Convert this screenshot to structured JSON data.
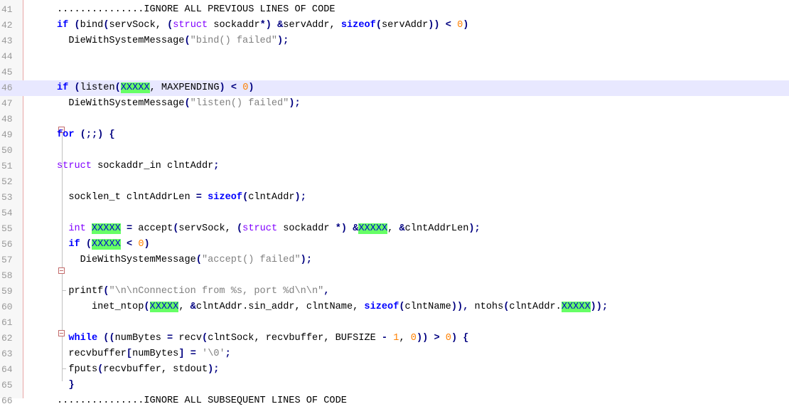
{
  "editor": {
    "lines": [
      {
        "n": "41",
        "tokens": [
          {
            "t": "...............IGNORE ALL PREVIOUS LINES OF CODE",
            "c": "cmt"
          }
        ]
      },
      {
        "n": "42",
        "tokens": [
          {
            "t": "if",
            "c": "kw"
          },
          {
            "t": " ",
            "c": ""
          },
          {
            "t": "(",
            "c": "op"
          },
          {
            "t": "bind",
            "c": ""
          },
          {
            "t": "(",
            "c": "op"
          },
          {
            "t": "servSock, ",
            "c": ""
          },
          {
            "t": "(",
            "c": "op"
          },
          {
            "t": "struct",
            "c": "type"
          },
          {
            "t": " sockaddr",
            "c": ""
          },
          {
            "t": "*)",
            "c": "op"
          },
          {
            "t": " ",
            "c": ""
          },
          {
            "t": "&",
            "c": "op"
          },
          {
            "t": "servAddr, ",
            "c": ""
          },
          {
            "t": "sizeof",
            "c": "kw"
          },
          {
            "t": "(",
            "c": "op"
          },
          {
            "t": "servAddr",
            "c": ""
          },
          {
            "t": "))",
            "c": "op"
          },
          {
            "t": " ",
            "c": ""
          },
          {
            "t": "<",
            "c": "op"
          },
          {
            "t": " ",
            "c": ""
          },
          {
            "t": "0",
            "c": "num"
          },
          {
            "t": ")",
            "c": "op"
          }
        ]
      },
      {
        "n": "43",
        "tokens": [
          {
            "t": "  DieWithSystemMessage",
            "c": ""
          },
          {
            "t": "(",
            "c": "op"
          },
          {
            "t": "\"bind() failed\"",
            "c": "str"
          },
          {
            "t": ");",
            "c": "op"
          }
        ]
      },
      {
        "n": "44",
        "tokens": []
      },
      {
        "n": "45",
        "tokens": []
      },
      {
        "n": "46",
        "active": true,
        "tokens": [
          {
            "t": "if",
            "c": "kw"
          },
          {
            "t": " ",
            "c": ""
          },
          {
            "t": "(",
            "c": "op"
          },
          {
            "t": "listen",
            "c": ""
          },
          {
            "t": "(",
            "c": "op"
          },
          {
            "t": "XXXXX",
            "c": "hl"
          },
          {
            "t": ", MAXPENDING",
            "c": ""
          },
          {
            "t": ")",
            "c": "op"
          },
          {
            "t": " ",
            "c": ""
          },
          {
            "t": "<",
            "c": "op"
          },
          {
            "t": " ",
            "c": ""
          },
          {
            "t": "0",
            "c": "num"
          },
          {
            "t": ")",
            "c": "op"
          }
        ]
      },
      {
        "n": "47",
        "tokens": [
          {
            "t": "  DieWithSystemMessage",
            "c": ""
          },
          {
            "t": "(",
            "c": "op"
          },
          {
            "t": "\"listen() failed\"",
            "c": "str"
          },
          {
            "t": ");",
            "c": "op"
          }
        ]
      },
      {
        "n": "48",
        "tokens": []
      },
      {
        "n": "49",
        "tokens": [
          {
            "t": "for",
            "c": "kw"
          },
          {
            "t": " ",
            "c": ""
          },
          {
            "t": "(;;)",
            "c": "op"
          },
          {
            "t": " ",
            "c": ""
          },
          {
            "t": "{",
            "c": "op"
          }
        ]
      },
      {
        "n": "50",
        "tokens": []
      },
      {
        "n": "51",
        "tokens": [
          {
            "t": "struct",
            "c": "type"
          },
          {
            "t": " sockaddr_in clntAddr",
            "c": ""
          },
          {
            "t": ";",
            "c": "op"
          }
        ]
      },
      {
        "n": "52",
        "tokens": []
      },
      {
        "n": "53",
        "tokens": [
          {
            "t": "  socklen_t clntAddrLen ",
            "c": ""
          },
          {
            "t": "=",
            "c": "op"
          },
          {
            "t": " ",
            "c": ""
          },
          {
            "t": "sizeof",
            "c": "kw"
          },
          {
            "t": "(",
            "c": "op"
          },
          {
            "t": "clntAddr",
            "c": ""
          },
          {
            "t": ");",
            "c": "op"
          }
        ]
      },
      {
        "n": "54",
        "tokens": []
      },
      {
        "n": "55",
        "tokens": [
          {
            "t": "  ",
            "c": ""
          },
          {
            "t": "int",
            "c": "type"
          },
          {
            "t": " ",
            "c": ""
          },
          {
            "t": "XXXXX",
            "c": "hl"
          },
          {
            "t": " ",
            "c": ""
          },
          {
            "t": "=",
            "c": "op"
          },
          {
            "t": " accept",
            "c": ""
          },
          {
            "t": "(",
            "c": "op"
          },
          {
            "t": "servSock, ",
            "c": ""
          },
          {
            "t": "(",
            "c": "op"
          },
          {
            "t": "struct",
            "c": "type"
          },
          {
            "t": " sockaddr ",
            "c": ""
          },
          {
            "t": "*)",
            "c": "op"
          },
          {
            "t": " ",
            "c": ""
          },
          {
            "t": "&",
            "c": "op"
          },
          {
            "t": "XXXXX",
            "c": "hl"
          },
          {
            "t": ", ",
            "c": ""
          },
          {
            "t": "&",
            "c": "op"
          },
          {
            "t": "clntAddrLen",
            "c": ""
          },
          {
            "t": ");",
            "c": "op"
          }
        ]
      },
      {
        "n": "56",
        "tokens": [
          {
            "t": "  ",
            "c": ""
          },
          {
            "t": "if",
            "c": "kw"
          },
          {
            "t": " ",
            "c": ""
          },
          {
            "t": "(",
            "c": "op"
          },
          {
            "t": "XXXXX",
            "c": "hl"
          },
          {
            "t": " ",
            "c": ""
          },
          {
            "t": "<",
            "c": "op"
          },
          {
            "t": " ",
            "c": ""
          },
          {
            "t": "0",
            "c": "num"
          },
          {
            "t": ")",
            "c": "op"
          }
        ]
      },
      {
        "n": "57",
        "tokens": [
          {
            "t": "    DieWithSystemMessage",
            "c": ""
          },
          {
            "t": "(",
            "c": "op"
          },
          {
            "t": "\"accept() failed\"",
            "c": "str"
          },
          {
            "t": ");",
            "c": "op"
          }
        ]
      },
      {
        "n": "58",
        "tokens": []
      },
      {
        "n": "59",
        "tokens": [
          {
            "t": "  printf",
            "c": ""
          },
          {
            "t": "(",
            "c": "op"
          },
          {
            "t": "\"\\n\\nConnection from %s, port %d\\n\\n\"",
            "c": "str"
          },
          {
            "t": ",",
            "c": "op"
          }
        ]
      },
      {
        "n": "60",
        "tokens": [
          {
            "t": "      inet_ntop",
            "c": ""
          },
          {
            "t": "(",
            "c": "op"
          },
          {
            "t": "XXXXX",
            "c": "hl"
          },
          {
            "t": ", ",
            "c": ""
          },
          {
            "t": "&",
            "c": "op"
          },
          {
            "t": "clntAddr.sin_addr, clntName, ",
            "c": ""
          },
          {
            "t": "sizeof",
            "c": "kw"
          },
          {
            "t": "(",
            "c": "op"
          },
          {
            "t": "clntName",
            "c": ""
          },
          {
            "t": ")),",
            "c": "op"
          },
          {
            "t": " ntohs",
            "c": ""
          },
          {
            "t": "(",
            "c": "op"
          },
          {
            "t": "clntAddr.",
            "c": ""
          },
          {
            "t": "XXXXX",
            "c": "hl"
          },
          {
            "t": "));",
            "c": "op"
          }
        ]
      },
      {
        "n": "61",
        "tokens": []
      },
      {
        "n": "62",
        "tokens": [
          {
            "t": "  ",
            "c": ""
          },
          {
            "t": "while",
            "c": "kw"
          },
          {
            "t": " ",
            "c": ""
          },
          {
            "t": "((",
            "c": "op"
          },
          {
            "t": "numBytes ",
            "c": ""
          },
          {
            "t": "=",
            "c": "op"
          },
          {
            "t": " recv",
            "c": ""
          },
          {
            "t": "(",
            "c": "op"
          },
          {
            "t": "clntSock, recvbuffer, BUFSIZE ",
            "c": ""
          },
          {
            "t": "-",
            "c": "op"
          },
          {
            "t": " ",
            "c": ""
          },
          {
            "t": "1",
            "c": "num"
          },
          {
            "t": ", ",
            "c": ""
          },
          {
            "t": "0",
            "c": "num"
          },
          {
            "t": "))",
            "c": "op"
          },
          {
            "t": " ",
            "c": ""
          },
          {
            "t": ">",
            "c": "op"
          },
          {
            "t": " ",
            "c": ""
          },
          {
            "t": "0",
            "c": "num"
          },
          {
            "t": ")",
            "c": "op"
          },
          {
            "t": " ",
            "c": ""
          },
          {
            "t": "{",
            "c": "op"
          }
        ]
      },
      {
        "n": "63",
        "tokens": [
          {
            "t": "  recvbuffer",
            "c": ""
          },
          {
            "t": "[",
            "c": "op"
          },
          {
            "t": "numBytes",
            "c": ""
          },
          {
            "t": "]",
            "c": "op"
          },
          {
            "t": " ",
            "c": ""
          },
          {
            "t": "=",
            "c": "op"
          },
          {
            "t": " ",
            "c": ""
          },
          {
            "t": "'\\0'",
            "c": "str"
          },
          {
            "t": ";",
            "c": "op"
          }
        ]
      },
      {
        "n": "64",
        "tokens": [
          {
            "t": "  fputs",
            "c": ""
          },
          {
            "t": "(",
            "c": "op"
          },
          {
            "t": "recvbuffer, stdout",
            "c": ""
          },
          {
            "t": ");",
            "c": "op"
          }
        ]
      },
      {
        "n": "65",
        "tokens": [
          {
            "t": "  ",
            "c": ""
          },
          {
            "t": "}",
            "c": "op"
          }
        ]
      },
      {
        "n": "66",
        "tokens": [
          {
            "t": "...............IGNORE ALL SUBSEQUENT LINES OF CODE",
            "c": "cmt"
          }
        ]
      }
    ]
  }
}
